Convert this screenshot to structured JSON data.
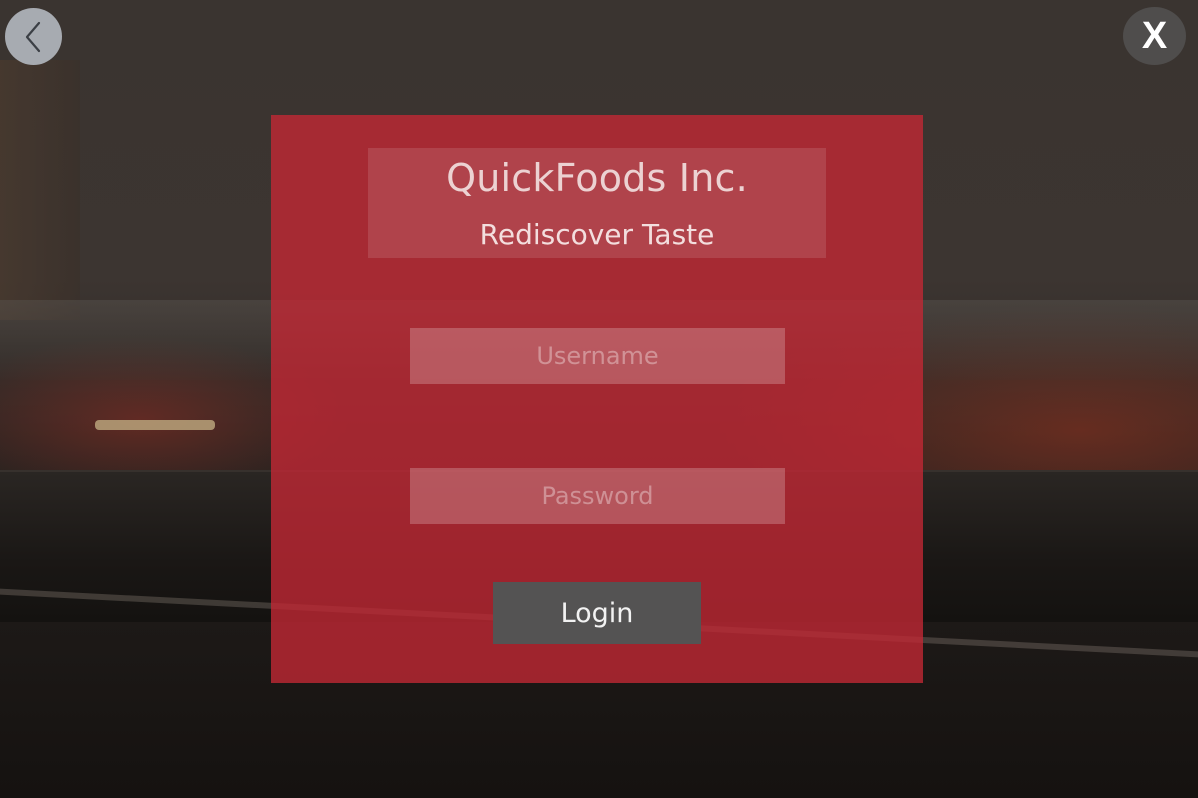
{
  "controls": {
    "back_icon": "chevron-left-icon",
    "close_label": "X"
  },
  "brand": {
    "title": "QuickFoods Inc.",
    "subtitle": "Rediscover Taste"
  },
  "form": {
    "username_placeholder": "Username",
    "username_value": "",
    "password_placeholder": "Password",
    "password_value": "",
    "login_label": "Login"
  },
  "colors": {
    "panel": "#c42834",
    "login_button": "#545353",
    "close_button": "#4f4d4c",
    "back_button": "#a7abb1"
  }
}
